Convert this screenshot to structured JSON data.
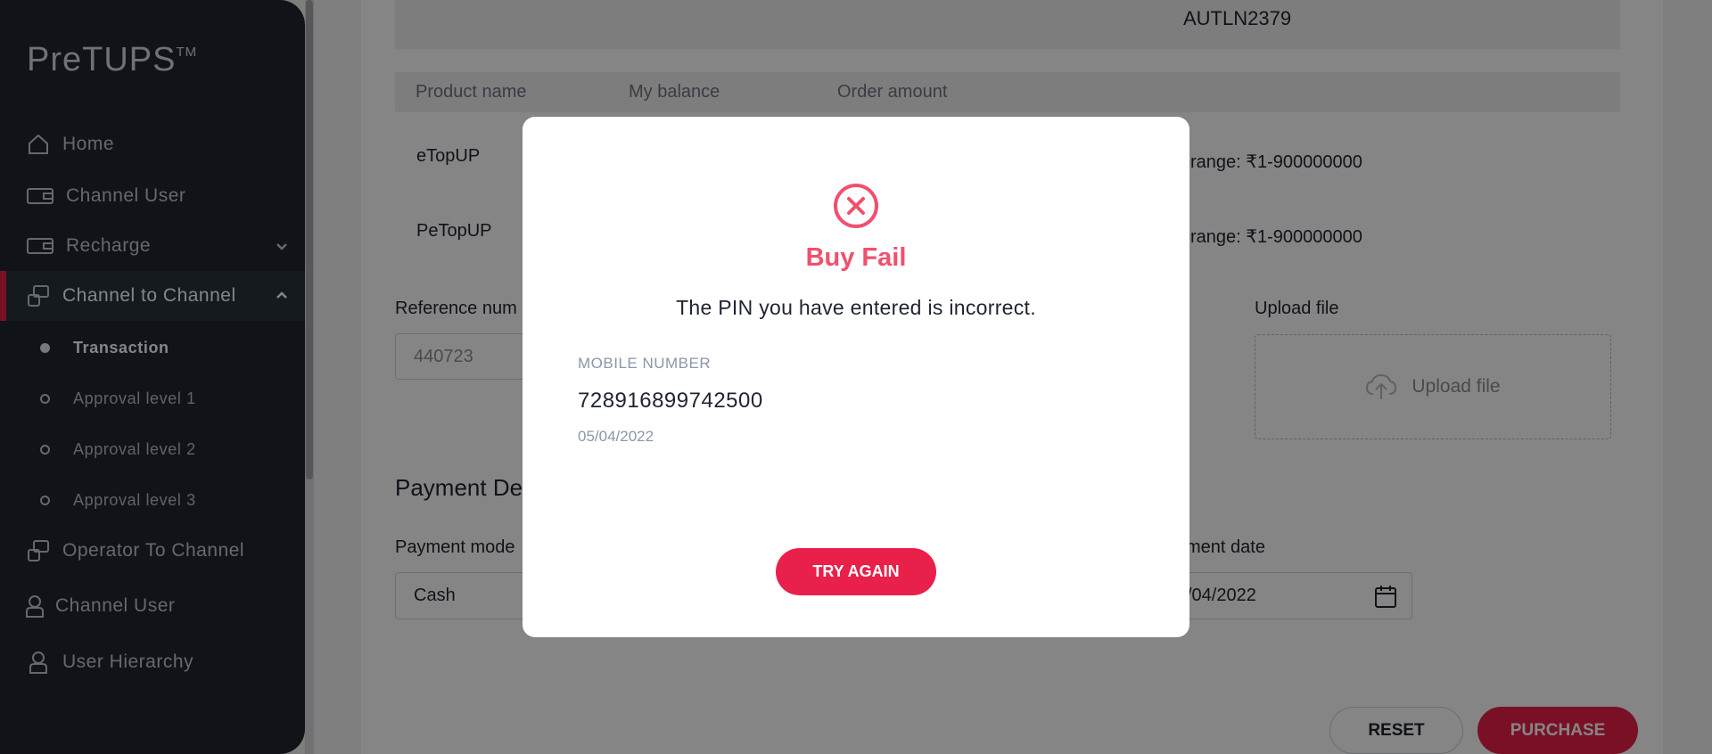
{
  "brand": {
    "name": "PreTUPS",
    "trademark": "TM"
  },
  "sidebar": {
    "items": [
      {
        "label": "Home",
        "icon": "home-icon"
      },
      {
        "label": "Channel User",
        "icon": "wallet-icon"
      },
      {
        "label": "Recharge",
        "icon": "wallet-icon"
      },
      {
        "label": "Channel to Channel",
        "icon": "transfer-icon"
      },
      {
        "label": "Operator To Channel",
        "icon": "transfer-icon"
      },
      {
        "label": "Channel User",
        "icon": "user-icon"
      },
      {
        "label": "User Hierarchy",
        "icon": "user-icon"
      }
    ],
    "subitems": [
      {
        "label": "Transaction"
      },
      {
        "label": "Approval level 1"
      },
      {
        "label": "Approval level 2"
      },
      {
        "label": "Approval level 3"
      }
    ]
  },
  "main": {
    "reference_code": "AUTLN2379",
    "table": {
      "headers": [
        "Product name",
        "My balance",
        "Order amount"
      ],
      "rows": [
        {
          "product": "eTopUP",
          "range": "range: ₹1-900000000"
        },
        {
          "product": "PeTopUP",
          "range": "range: ₹1-900000000"
        }
      ]
    },
    "reference_label": "Reference num",
    "reference_value": "440723",
    "upload_label": "Upload file",
    "upload_button": "Upload file",
    "payment_section_title": "Payment De",
    "payment_mode_label": "Payment mode",
    "payment_mode_value": "Cash",
    "payment_date_label": "ment date",
    "payment_date_value": "/04/2022",
    "reset_label": "RESET",
    "purchase_label": "PURCHASE"
  },
  "modal": {
    "title": "Buy Fail",
    "message": "The PIN you have entered is incorrect.",
    "mobile_label": "MOBILE NUMBER",
    "mobile_value": "728916899742500",
    "date": "05/04/2022",
    "button_label": "TRY AGAIN"
  },
  "colors": {
    "accent": "#e8204a",
    "error": "#f0506e",
    "sidebar_bg": "#1f262e"
  }
}
